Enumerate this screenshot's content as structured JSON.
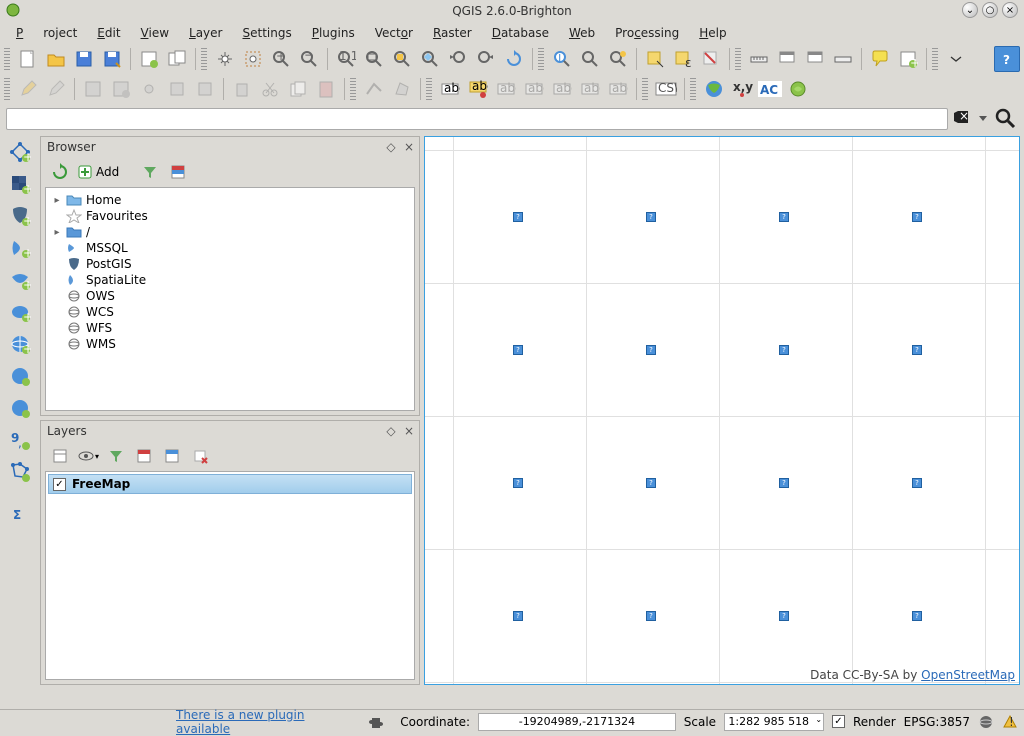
{
  "window": {
    "title": "QGIS 2.6.0-Brighton"
  },
  "menubar": [
    "Project",
    "Edit",
    "View",
    "Layer",
    "Settings",
    "Plugins",
    "Vector",
    "Raster",
    "Database",
    "Web",
    "Processing",
    "Help"
  ],
  "toolbar1_icons": [
    "new-project",
    "open-project",
    "save-project",
    "save-as",
    "print-composer",
    "composer-manager",
    "sep",
    "pan",
    "pan-selected",
    "zoom-in",
    "zoom-out",
    "zoom-native",
    "zoom-full",
    "zoom-selection",
    "zoom-layer",
    "zoom-last",
    "zoom-next",
    "refresh",
    "sep",
    "identify",
    "lookup",
    "run-query",
    "select",
    "select-expr",
    "deselect",
    "sep",
    "measure",
    "measure-area",
    "map-tips",
    "bookmark",
    "sep",
    "annotation",
    "new-layer",
    "sep",
    "help"
  ],
  "toolbar2_icons": [
    "edit-toggle",
    "save-edits",
    "save-edits2",
    "sep",
    "add-feature",
    "move",
    "node",
    "sep",
    "cut",
    "copy",
    "paste",
    "delete",
    "sep",
    "line",
    "polygon",
    "sep",
    "text-annot",
    "label",
    "label-move",
    "label-rotate",
    "label-change",
    "label-hide",
    "label-pin",
    "csw",
    "sep",
    "globe",
    "xy",
    "ac",
    "web"
  ],
  "browser": {
    "title": "Browser",
    "add_label": "Add",
    "items": [
      {
        "label": "Home",
        "icon": "folder",
        "expand": true
      },
      {
        "label": "Favourites",
        "icon": "star",
        "expand": false
      },
      {
        "label": "/",
        "icon": "folder-blue",
        "expand": true
      },
      {
        "label": "MSSQL",
        "icon": "mssql",
        "expand": false
      },
      {
        "label": "PostGIS",
        "icon": "postgis",
        "expand": false
      },
      {
        "label": "SpatiaLite",
        "icon": "spatialite",
        "expand": false
      },
      {
        "label": "OWS",
        "icon": "ows",
        "expand": false
      },
      {
        "label": "WCS",
        "icon": "wcs",
        "expand": false
      },
      {
        "label": "WFS",
        "icon": "wfs",
        "expand": false
      },
      {
        "label": "WMS",
        "icon": "wms",
        "expand": false
      }
    ]
  },
  "layers": {
    "title": "Layers",
    "items": [
      {
        "label": "FreeMap",
        "checked": true
      }
    ]
  },
  "attribution": {
    "text": "Data CC-By-SA by ",
    "link": "OpenStreetMap"
  },
  "statusbar": {
    "plugin_msg": "There is a new plugin available",
    "coord_label": "Coordinate:",
    "coord_value": "-19204989,-2171324",
    "scale_label": "Scale",
    "scale_value": "1:282 985 518",
    "render_label": "Render",
    "epsg": "EPSG:3857"
  }
}
